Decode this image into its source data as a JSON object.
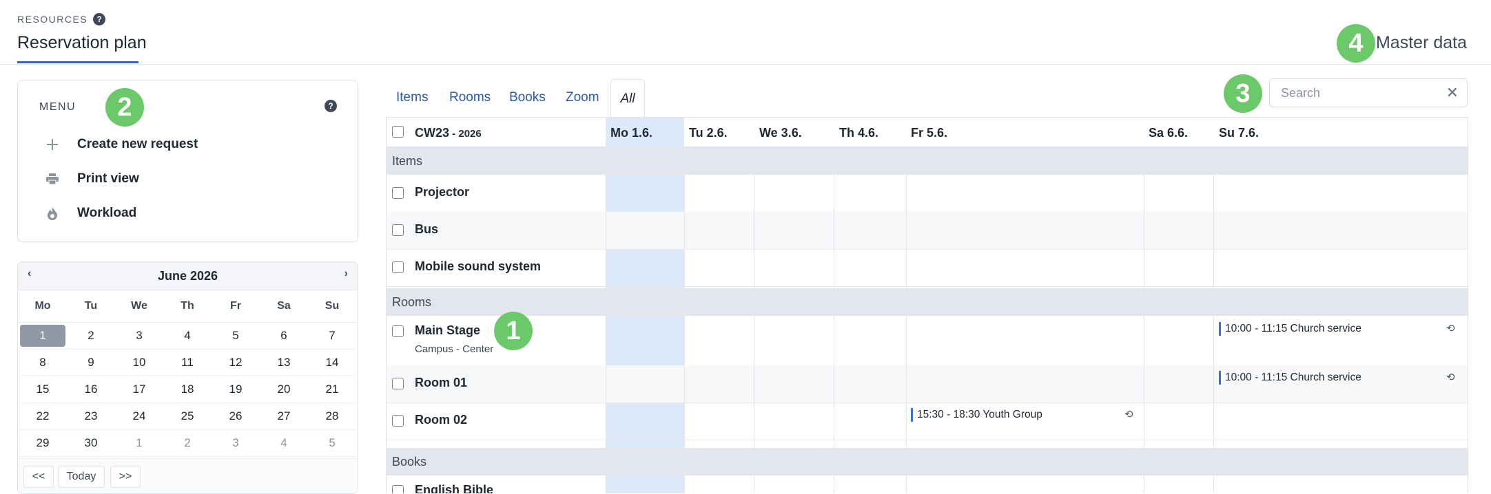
{
  "header": {
    "eyebrow": "RESOURCES",
    "help": "?",
    "title": "Reservation plan",
    "master_data_label": "Master data"
  },
  "badges": [
    "1",
    "2",
    "3",
    "4"
  ],
  "menu": {
    "title": "MENU",
    "help": "?",
    "items": [
      {
        "label": "Create new request",
        "icon": "plus-icon"
      },
      {
        "label": "Print view",
        "icon": "printer-icon"
      },
      {
        "label": "Workload",
        "icon": "flame-icon"
      }
    ]
  },
  "calendar": {
    "month_label": "June 2026",
    "prev": "‹",
    "next": "›",
    "weekdays": [
      "Mo",
      "Tu",
      "We",
      "Th",
      "Fr",
      "Sa",
      "Su"
    ],
    "days": [
      [
        "1",
        "2",
        "3",
        "4",
        "5",
        "6",
        "7"
      ],
      [
        "8",
        "9",
        "10",
        "11",
        "12",
        "13",
        "14"
      ],
      [
        "15",
        "16",
        "17",
        "18",
        "19",
        "20",
        "21"
      ],
      [
        "22",
        "23",
        "24",
        "25",
        "26",
        "27",
        "28"
      ],
      [
        "29",
        "30",
        "1",
        "2",
        "3",
        "4",
        "5"
      ]
    ],
    "selected_day": "1",
    "footer": {
      "prev": "<<",
      "today": "Today",
      "next": ">>"
    }
  },
  "tabs": [
    {
      "label": "Items"
    },
    {
      "label": "Rooms"
    },
    {
      "label": "Books"
    },
    {
      "label": "Zoom"
    },
    {
      "label": "All",
      "active": true
    }
  ],
  "search": {
    "placeholder": "Search",
    "clear": "✕"
  },
  "schedule": {
    "week_label": "CW23",
    "week_year": " - 2026",
    "days": [
      "Mo 1.6.",
      "Tu 2.6.",
      "We 3.6.",
      "Th 4.6.",
      "Fr 5.6.",
      "Sa 6.6.",
      "Su 7.6."
    ],
    "today_index": 0,
    "sections": {
      "items": {
        "label": "Items",
        "resources": [
          {
            "name": "Projector"
          },
          {
            "name": "Bus"
          },
          {
            "name": "Mobile sound system"
          }
        ]
      },
      "rooms": {
        "label": "Rooms",
        "resources": [
          {
            "name": "Main Stage",
            "location": "Campus - Center"
          },
          {
            "name": "Room 01"
          },
          {
            "name": "Room 02"
          }
        ]
      },
      "books": {
        "label": "Books",
        "resources": [
          {
            "name": "English Bible"
          }
        ]
      }
    },
    "events": [
      {
        "resource": "Main Stage",
        "day": "Su 7.6.",
        "text": "10:00 - 11:15 Church service",
        "recurring": true
      },
      {
        "resource": "Room 01",
        "day": "Su 7.6.",
        "text": "10:00 - 11:15 Church service",
        "recurring": true
      },
      {
        "resource": "Room 02",
        "day": "Fr 5.6.",
        "text": "15:30 - 18:30 Youth Group",
        "recurring": true
      }
    ],
    "repeat_glyph": "⟲"
  },
  "colors": {
    "accent": "#2f63c8",
    "badge": "#6cc96a",
    "today_column": "#dde8f8",
    "section_bg": "#e3e7ed"
  }
}
